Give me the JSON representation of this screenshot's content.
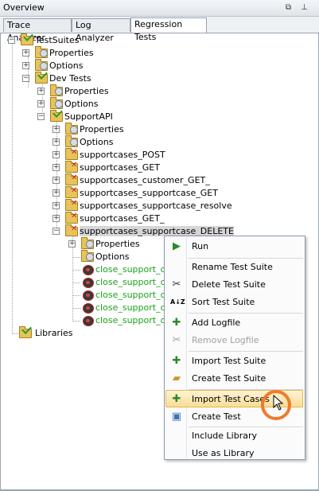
{
  "panel": {
    "title": "Overview",
    "pin_icon": "pin-icon",
    "close_icon": "unpin-icon"
  },
  "tabs": [
    {
      "label": "Trace Analyzer"
    },
    {
      "label": "Log Analyzer"
    },
    {
      "label": "Regression Tests",
      "active": true
    }
  ],
  "tree": {
    "root": "TestSuites",
    "properties": "Properties",
    "options": "Options",
    "dev_tests": "Dev Tests",
    "dev_properties": "Properties",
    "dev_options": "Options",
    "support_api": "SupportAPI",
    "api_properties": "Properties",
    "api_options": "Options",
    "suites": [
      "supportcases_POST",
      "supportcases_GET",
      "supportcases_customer_GET_",
      "supportcases_supportcase_GET",
      "supportcases_supportcase_resolve",
      "supportcases_GET_",
      "supportcases_supportcase_DELETE"
    ],
    "del_properties": "Properties",
    "del_options": "Options",
    "cases": [
      "close_support_cas",
      "close_support_cas",
      "close_support_cas",
      "close_support_cas",
      "close_support_cas"
    ],
    "libraries": "Libraries"
  },
  "menu": {
    "run": "Run",
    "rename": "Rename Test Suite",
    "delete": "Delete Test Suite",
    "sort": "Sort Test Suite",
    "add_logfile": "Add Logfile",
    "remove_logfile": "Remove Logfile",
    "import_suite": "Import Test Suite",
    "create_suite": "Create Test Suite",
    "import_cases": "Import Test Cases",
    "create_test": "Create Test",
    "include_library": "Include Library",
    "use_as_library": "Use as Library",
    "sort_icon_text": "A↓Z"
  }
}
